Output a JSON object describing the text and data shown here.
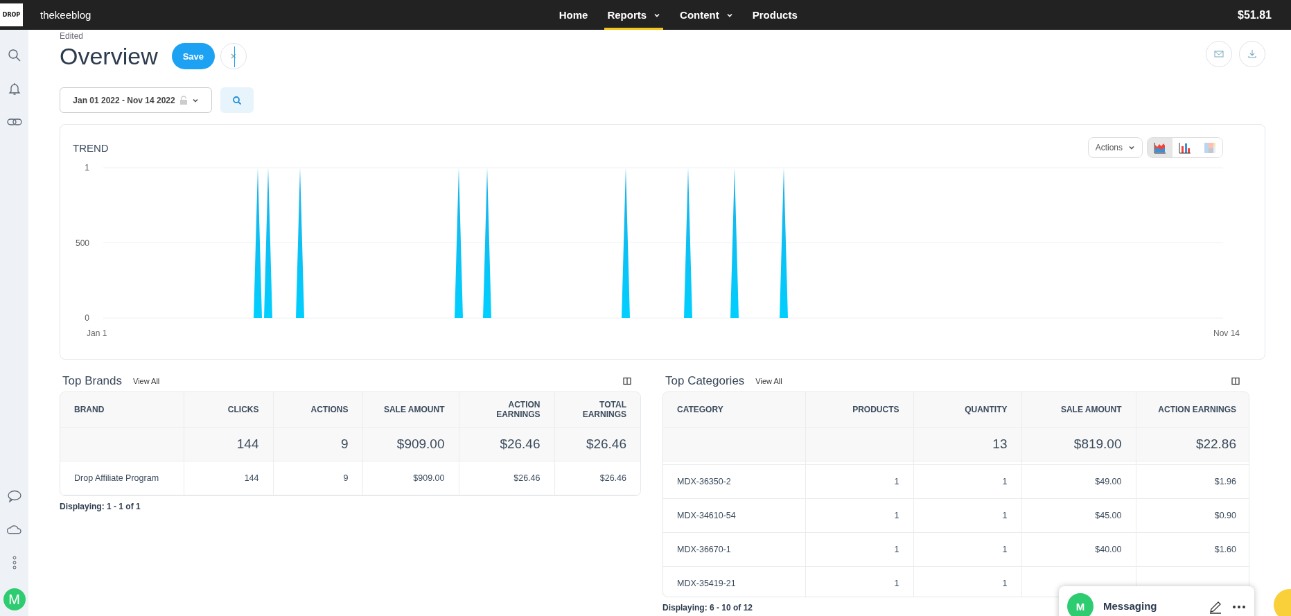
{
  "top_bar": {
    "logo_text": "DROP",
    "site": "thekeeblog",
    "nav": [
      {
        "label": "Home",
        "selected": false,
        "has_menu": false
      },
      {
        "label": "Reports",
        "selected": true,
        "has_menu": true
      },
      {
        "label": "Content",
        "selected": false,
        "has_menu": true
      },
      {
        "label": "Products",
        "selected": false,
        "has_menu": false
      }
    ],
    "balance": "$51.81"
  },
  "sidebar": {
    "avatar": "M"
  },
  "header": {
    "status": "Edited",
    "title": "Overview",
    "save": "Save"
  },
  "filters": {
    "date_range": "Jan 01 2022 - Nov 14 2022"
  },
  "trend": {
    "title": "TREND",
    "actions": "Actions",
    "views": [
      {
        "kind": "area",
        "selected": true
      },
      {
        "kind": "bar",
        "selected": false
      },
      {
        "kind": "treemap",
        "selected": false
      }
    ],
    "y_labels": [
      "1",
      "500",
      "0"
    ],
    "x_labels": [
      "Jan 1",
      "Nov 14"
    ]
  },
  "top_brands": {
    "title": "Top Brands",
    "view_all": "View All",
    "columns": [
      "BRAND",
      "CLICKS",
      "ACTIONS",
      "SALE AMOUNT",
      "ACTION EARNINGS",
      "TOTAL EARNINGS"
    ],
    "totals": [
      "144",
      "9",
      "$909.00",
      "$26.46",
      "$26.46"
    ],
    "rows": [
      [
        "Drop Affiliate Program",
        "144",
        "9",
        "$909.00",
        "$26.46",
        "$26.46"
      ]
    ],
    "footer": "Displaying: 1 - 1 of 1"
  },
  "top_categories": {
    "title": "Top Categories",
    "view_all": "View All",
    "columns": [
      "CATEGORY",
      "PRODUCTS",
      "QUANTITY",
      "SALE AMOUNT",
      "ACTION EARNINGS"
    ],
    "totals": [
      "13",
      "$819.00",
      "$22.86"
    ],
    "rows": [
      [
        "MDX-36350-2",
        "1",
        "1",
        "$49.00",
        "$1.96"
      ],
      [
        "MDX-34610-54",
        "1",
        "1",
        "$45.00",
        "$0.90"
      ],
      [
        "MDX-36670-1",
        "1",
        "1",
        "$40.00",
        "$1.60"
      ],
      [
        "MDX-35419-21",
        "1",
        "1"
      ]
    ],
    "footer": "Displaying: 6 - 10 of 12"
  },
  "messaging": {
    "avatar": "M",
    "title": "Messaging"
  }
}
